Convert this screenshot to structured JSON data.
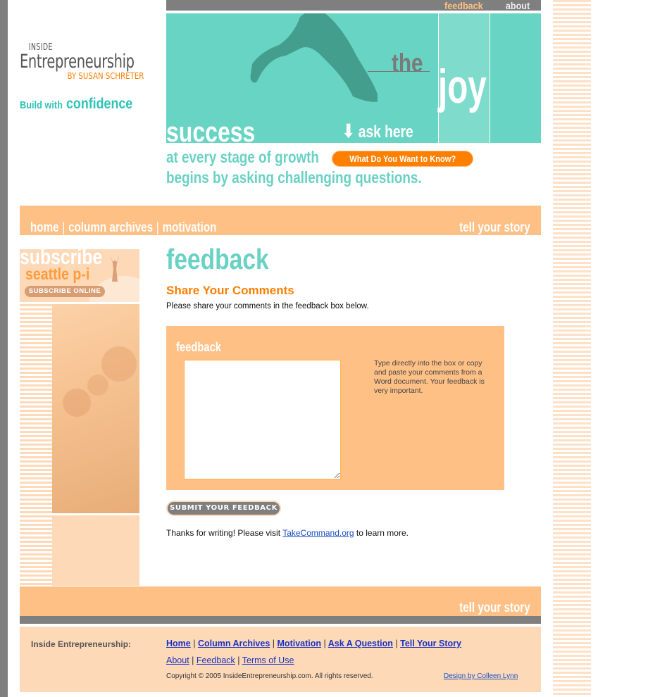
{
  "brand": {
    "logo_line1": "Inside",
    "logo_line2": "Entrepreneurship",
    "logo_byline": "by Susan Schreter",
    "tagline_a": "Build with",
    "tagline_b": "confidence"
  },
  "top_nav": {
    "items": [
      {
        "label": "feedback",
        "active": true
      },
      {
        "label": "about",
        "active": false
      }
    ]
  },
  "hero": {
    "word_the": "the",
    "word_joy": "joy",
    "word_success": "success",
    "ask_label": "ask here",
    "arrow_icon": "down-arrow-icon",
    "line1": "at every stage of growth",
    "line2": "begins by asking challenging questions.",
    "cta_button": "What Do You Want to Know?"
  },
  "main_nav": {
    "items": [
      "home",
      "column archives",
      "motivation"
    ],
    "separator": "|",
    "right_link": "tell your story"
  },
  "sidebar": {
    "subscribe_title": "subscribe",
    "subscribe_sub": "seattle p-i",
    "subscribe_button": "SUBSCRIBE ONLINE"
  },
  "content": {
    "page_title": "feedback",
    "section_title": "Share Your Comments",
    "intro": "Please share your comments in the feedback box below.",
    "form_label": "feedback",
    "textarea_value": "",
    "help_text": "Type directly into the box or copy and paste your comments from a Word document. Your feedback is very important.",
    "submit_button": "SUBMIT YOUR FEEDBACK",
    "thanks_before": "Thanks for writing! Please visit ",
    "thanks_link": "TakeCommand.org",
    "thanks_after": " to learn more."
  },
  "bottom_bar": {
    "right_link": "tell your story"
  },
  "footer": {
    "brand": "Inside Entrepreneurship:",
    "row1": [
      "Home",
      "Column Archives",
      "Motivation",
      "Ask A Question",
      "Tell Your Story"
    ],
    "row2": [
      "About",
      "Feedback",
      "Terms of Use"
    ],
    "separator": "|",
    "copyright": "Copyright © 2005 InsideEntrepreneurship.com. All rights reserved.",
    "design_credit": "Design by Colleen Lynn"
  },
  "colors": {
    "teal": "#6ad2c5",
    "orange": "#ff7f00",
    "peach": "#ffc086",
    "light_peach": "#fdd9b8",
    "gray": "#7f7f7f",
    "link_blue": "#1a32c4"
  }
}
